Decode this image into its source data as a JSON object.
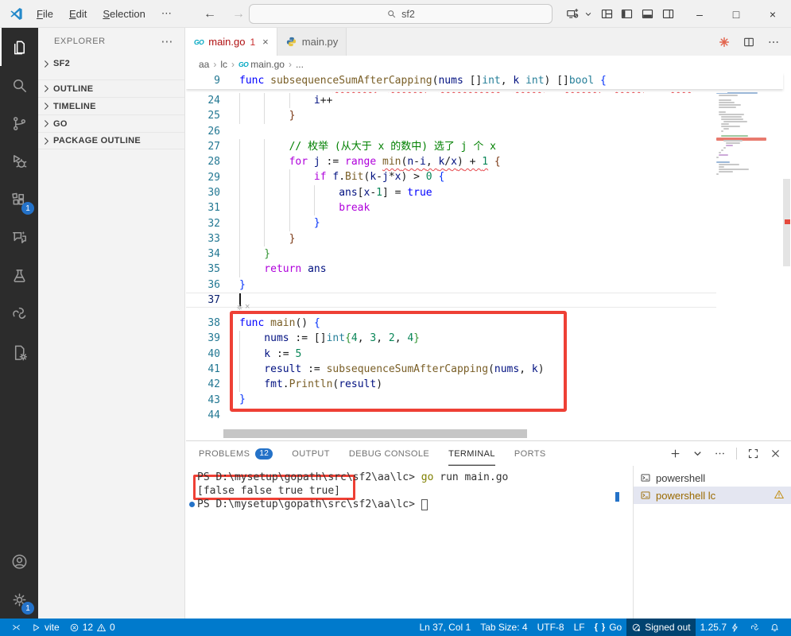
{
  "titlebar": {
    "menus": [
      "File",
      "Edit",
      "Selection"
    ],
    "more": "⋯",
    "search": "sf2",
    "nav_back": "←",
    "nav_forward": "→",
    "window_controls": {
      "min": "–",
      "max": "□",
      "close": "×"
    }
  },
  "activity_bar": {
    "top": [
      {
        "name": "explorer",
        "icon": "files",
        "active": true
      },
      {
        "name": "search",
        "icon": "search"
      },
      {
        "name": "source-control",
        "icon": "branch"
      },
      {
        "name": "run-and-debug",
        "icon": "debug"
      },
      {
        "name": "extensions",
        "icon": "extensions",
        "badge": "1"
      },
      {
        "name": "chat",
        "icon": "chat"
      },
      {
        "name": "testing",
        "icon": "beaker"
      },
      {
        "name": "go-tools",
        "icon": "knot"
      },
      {
        "name": "snippets",
        "icon": "filegear"
      }
    ],
    "bottom": [
      {
        "name": "accounts",
        "icon": "account"
      },
      {
        "name": "manage",
        "icon": "gear",
        "badge": "1"
      }
    ]
  },
  "sidebar": {
    "title": "EXPLORER",
    "more": "⋯",
    "sections": [
      {
        "label": "SF2"
      },
      {
        "label": "OUTLINE"
      },
      {
        "label": "TIMELINE"
      },
      {
        "label": "GO"
      },
      {
        "label": "PACKAGE OUTLINE"
      }
    ]
  },
  "editor": {
    "tabs": [
      {
        "label": "main.go",
        "icon": "goico",
        "badge": "1",
        "close": "×",
        "active": true,
        "error": true
      },
      {
        "label": "main.py",
        "icon": "python"
      }
    ],
    "breadcrumbs": [
      {
        "label": "aa"
      },
      {
        "label": "lc"
      },
      {
        "label": "main.go",
        "icon": "goico"
      },
      {
        "label": "..."
      }
    ],
    "sticky": {
      "n": "9",
      "i": 0,
      "s": [
        [
          "func",
          "b"
        ],
        [
          " ",
          "p"
        ],
        [
          "subsequenceSumAfterCapping",
          "f"
        ],
        [
          "(",
          "p"
        ],
        [
          "nums",
          "v"
        ],
        [
          " []",
          "p"
        ],
        [
          "int",
          "t"
        ],
        [
          ", ",
          "p"
        ],
        [
          "k",
          "v"
        ],
        [
          " ",
          "p"
        ],
        [
          "int",
          "t"
        ],
        [
          ") []",
          "p"
        ],
        [
          "bool",
          "t"
        ],
        [
          " {",
          "d1"
        ]
      ]
    },
    "sliver": [
      [
        "               ",
        "p"
      ],
      [
        "xxxxxxx",
        "sq"
      ],
      [
        "  ",
        "p"
      ],
      [
        "xxxxxx",
        "sq"
      ],
      [
        "  ",
        "p"
      ],
      [
        "xxxxxxxxxx",
        "sq"
      ],
      [
        "  ",
        "p"
      ],
      [
        "xxxxx",
        "sq"
      ],
      [
        "   ",
        "p"
      ],
      [
        "xxxxxx",
        "sq"
      ],
      [
        "  ",
        "p"
      ],
      [
        "xxxxx",
        "sq"
      ],
      [
        "    ",
        "p"
      ],
      [
        "xxxx",
        "sq"
      ]
    ],
    "lines_a": [
      {
        "n": 24,
        "i": 3,
        "s": [
          [
            "i",
            "v"
          ],
          [
            "++",
            "p"
          ]
        ]
      },
      {
        "n": 25,
        "i": 2,
        "s": [
          [
            "}",
            "d3"
          ]
        ]
      },
      {
        "n": 26,
        "i": 0,
        "s": []
      },
      {
        "n": 27,
        "i": 2,
        "s": [
          [
            "// 枚举 (从大于 x 的数中) 选了 j 个 x",
            "c"
          ]
        ]
      },
      {
        "n": 28,
        "i": 2,
        "s": [
          [
            "for",
            "k"
          ],
          [
            " ",
            "p"
          ],
          [
            "j",
            "v"
          ],
          [
            " := ",
            "p"
          ],
          [
            "range",
            "k"
          ],
          [
            " ",
            "p"
          ],
          [
            "min",
            "f e"
          ],
          [
            "(",
            "p e"
          ],
          [
            "n",
            "v e"
          ],
          [
            "-",
            "p e"
          ],
          [
            "i",
            "v e"
          ],
          [
            ", ",
            "p e"
          ],
          [
            "k",
            "v e"
          ],
          [
            "/",
            "p e"
          ],
          [
            "x",
            "v e"
          ],
          [
            ")",
            "p e"
          ],
          [
            " + ",
            "p e"
          ],
          [
            "1",
            "n e"
          ],
          [
            " {",
            "d3"
          ]
        ]
      },
      {
        "n": 29,
        "i": 3,
        "s": [
          [
            "if",
            "k"
          ],
          [
            " ",
            "p"
          ],
          [
            "f",
            "v"
          ],
          [
            ".",
            "p"
          ],
          [
            "Bit",
            "f"
          ],
          [
            "(",
            "p"
          ],
          [
            "k",
            "v"
          ],
          [
            "-",
            "p"
          ],
          [
            "j",
            "v"
          ],
          [
            "*",
            "p"
          ],
          [
            "x",
            "v"
          ],
          [
            ") > ",
            "p"
          ],
          [
            "0",
            "n"
          ],
          [
            " {",
            "d1"
          ]
        ]
      },
      {
        "n": 30,
        "i": 4,
        "s": [
          [
            "ans",
            "v"
          ],
          [
            "[",
            "p"
          ],
          [
            "x",
            "v"
          ],
          [
            "-",
            "p"
          ],
          [
            "1",
            "n"
          ],
          [
            "] = ",
            "p"
          ],
          [
            "true",
            "b"
          ]
        ]
      },
      {
        "n": 31,
        "i": 4,
        "s": [
          [
            "break",
            "k"
          ]
        ]
      },
      {
        "n": 32,
        "i": 3,
        "s": [
          [
            "}",
            "d1"
          ]
        ]
      },
      {
        "n": 33,
        "i": 2,
        "s": [
          [
            "}",
            "d3"
          ]
        ]
      },
      {
        "n": 34,
        "i": 1,
        "s": [
          [
            "}",
            "d2"
          ]
        ]
      },
      {
        "n": 35,
        "i": 1,
        "s": [
          [
            "return",
            "k"
          ],
          [
            " ",
            "p"
          ],
          [
            "ans",
            "v"
          ]
        ]
      },
      {
        "n": 36,
        "i": 0,
        "s": [
          [
            "}",
            "d1"
          ]
        ]
      },
      {
        "n": 37,
        "i": 0,
        "s": [],
        "cursor": true,
        "current": true
      }
    ],
    "lines_b": [
      {
        "n": 38,
        "i": 0,
        "s": [
          [
            "func",
            "b"
          ],
          [
            " ",
            "p"
          ],
          [
            "main",
            "f"
          ],
          [
            "() ",
            "p"
          ],
          [
            "{",
            "d1"
          ]
        ]
      },
      {
        "n": 39,
        "i": 1,
        "s": [
          [
            "nums",
            "v"
          ],
          [
            " := []",
            "p"
          ],
          [
            "int",
            "t"
          ],
          [
            "{",
            "d2"
          ],
          [
            "4",
            "n"
          ],
          [
            ", ",
            "p"
          ],
          [
            "3",
            "n"
          ],
          [
            ", ",
            "p"
          ],
          [
            "2",
            "n"
          ],
          [
            ", ",
            "p"
          ],
          [
            "4",
            "n"
          ],
          [
            "}",
            "d2"
          ]
        ]
      },
      {
        "n": 40,
        "i": 1,
        "s": [
          [
            "k",
            "v"
          ],
          [
            " := ",
            "p"
          ],
          [
            "5",
            "n"
          ]
        ]
      },
      {
        "n": 41,
        "i": 1,
        "s": [
          [
            "result",
            "v"
          ],
          [
            " := ",
            "p"
          ],
          [
            "subsequenceSumAfterCapping",
            "f"
          ],
          [
            "(",
            "p"
          ],
          [
            "nums",
            "v"
          ],
          [
            ", ",
            "p"
          ],
          [
            "k",
            "v"
          ],
          [
            ")",
            "p"
          ]
        ]
      },
      {
        "n": 42,
        "i": 1,
        "s": [
          [
            "fmt",
            "v"
          ],
          [
            ".",
            "p"
          ],
          [
            "Println",
            "f"
          ],
          [
            "(",
            "p"
          ],
          [
            "result",
            "v"
          ],
          [
            ")",
            "p"
          ]
        ]
      },
      {
        "n": 43,
        "i": 0,
        "s": [
          [
            "}",
            "d1"
          ]
        ]
      },
      {
        "n": 44,
        "i": 0,
        "s": []
      }
    ]
  },
  "minimap": {
    "rows": [
      [
        0,
        26,
        "b"
      ],
      [
        0,
        0,
        "g"
      ],
      [
        0,
        18,
        "g"
      ],
      [
        3,
        12,
        "g"
      ],
      [
        3,
        14,
        "g"
      ],
      [
        0,
        3,
        "g"
      ],
      [
        0,
        0,
        "g"
      ],
      [
        0,
        0,
        "g"
      ],
      [
        0,
        52,
        "b"
      ],
      [
        3,
        24,
        "g"
      ],
      [
        0,
        0,
        "g"
      ],
      [
        3,
        16,
        "g"
      ],
      [
        3,
        20,
        "g"
      ],
      [
        3,
        28,
        "g"
      ],
      [
        3,
        22,
        "g"
      ],
      [
        0,
        0,
        "g"
      ],
      [
        3,
        9,
        "g"
      ],
      [
        3,
        32,
        "g"
      ],
      [
        6,
        26,
        "g"
      ],
      [
        6,
        28,
        "g"
      ],
      [
        9,
        30,
        "g"
      ],
      [
        6,
        10,
        "g"
      ],
      [
        6,
        24,
        "g"
      ],
      [
        9,
        7,
        "g"
      ],
      [
        6,
        3,
        "g"
      ],
      [
        0,
        0,
        "g"
      ],
      [
        6,
        34,
        "n"
      ],
      [
        0,
        60,
        "r"
      ],
      [
        9,
        24,
        "g"
      ],
      [
        12,
        18,
        "g"
      ],
      [
        12,
        9,
        "p"
      ],
      [
        9,
        3,
        "g"
      ],
      [
        6,
        3,
        "g"
      ],
      [
        3,
        3,
        "g"
      ],
      [
        3,
        12,
        "p"
      ],
      [
        0,
        3,
        "g"
      ],
      [
        0,
        0,
        "g"
      ],
      [
        0,
        17,
        "b"
      ],
      [
        3,
        26,
        "g"
      ],
      [
        3,
        7,
        "g"
      ],
      [
        3,
        38,
        "g"
      ],
      [
        3,
        18,
        "g"
      ],
      [
        0,
        3,
        "g"
      ],
      [
        0,
        0,
        "g"
      ]
    ]
  },
  "panel": {
    "tabs": [
      {
        "label": "PROBLEMS",
        "badge": "12"
      },
      {
        "label": "OUTPUT"
      },
      {
        "label": "DEBUG CONSOLE"
      },
      {
        "label": "TERMINAL",
        "active": true
      },
      {
        "label": "PORTS"
      }
    ],
    "terminal": {
      "lines": [
        {
          "s": [
            [
              "PS D:\\mysetup\\gopath\\src\\sf2\\aa\\lc> ",
              "t-p"
            ],
            [
              "go",
              "t-cmd"
            ],
            [
              " run main.go",
              "t-p"
            ]
          ]
        },
        {
          "s": [
            [
              "[false false true true]",
              "t-p"
            ]
          ],
          "boxed": true
        },
        {
          "s": [
            [
              "PS D:\\mysetup\\gopath\\src\\sf2\\aa\\lc> ",
              "t-p"
            ]
          ],
          "dot": true,
          "cursor": true
        }
      ]
    },
    "terminal_list": [
      {
        "label": "powershell",
        "icon": "terminal"
      },
      {
        "label": "powershell lc",
        "icon": "terminal",
        "selected": true,
        "warning": true
      }
    ]
  },
  "status_bar": {
    "left": [
      {
        "name": "remote-indicator",
        "icon": "remote"
      },
      {
        "name": "task-vite",
        "icon": "play",
        "text": "vite"
      },
      {
        "name": "problems-summary",
        "icon": "error",
        "text": "12",
        "icon2": "warning",
        "text2": "0"
      }
    ],
    "right": [
      {
        "name": "cursor-position",
        "text": "Ln 37, Col 1"
      },
      {
        "name": "tab-size",
        "text": "Tab Size: 4"
      },
      {
        "name": "encoding",
        "text": "UTF-8"
      },
      {
        "name": "eol",
        "text": "LF"
      },
      {
        "name": "language-mode",
        "icon": "braces",
        "text": "Go"
      },
      {
        "name": "accounts-signed-out",
        "icon": "signedout",
        "text": "Signed out",
        "prominent": true
      },
      {
        "name": "go-version",
        "text": "1.25.7",
        "icon2": "bolt"
      },
      {
        "name": "go-tools-status",
        "icon": "knot"
      },
      {
        "name": "notifications",
        "icon": "bell"
      }
    ]
  }
}
